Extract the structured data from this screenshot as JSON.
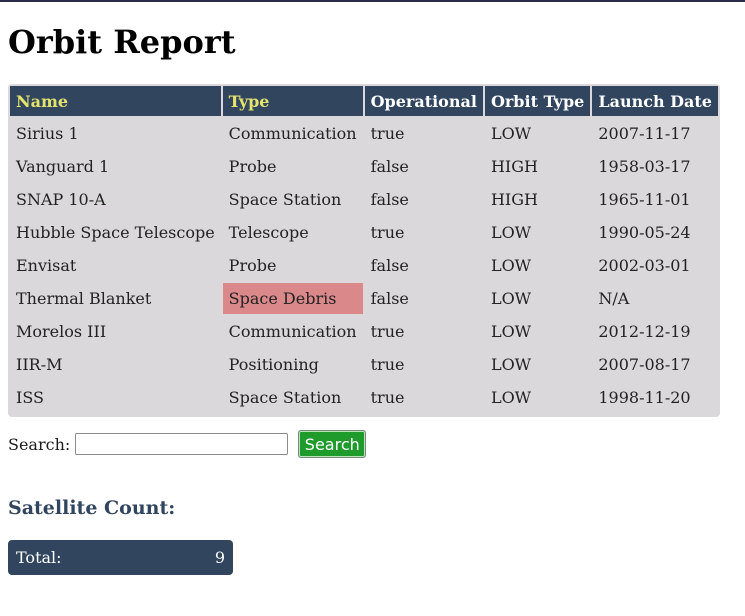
{
  "page": {
    "title": "Orbit Report"
  },
  "table": {
    "headers": [
      "Name",
      "Type",
      "Operational",
      "Orbit Type",
      "Launch Date"
    ],
    "rows": [
      [
        "Sirius 1",
        "Communication",
        "true",
        "LOW",
        "2007-11-17"
      ],
      [
        "Vanguard 1",
        "Probe",
        "false",
        "HIGH",
        "1958-03-17"
      ],
      [
        "SNAP 10-A",
        "Space Station",
        "false",
        "HIGH",
        "1965-11-01"
      ],
      [
        "Hubble Space Telescope",
        "Telescope",
        "true",
        "LOW",
        "1990-05-24"
      ],
      [
        "Envisat",
        "Probe",
        "false",
        "LOW",
        "2002-03-01"
      ],
      [
        "Thermal Blanket",
        "Space Debris",
        "false",
        "LOW",
        "N/A"
      ],
      [
        "Morelos III",
        "Communication",
        "true",
        "LOW",
        "2012-12-19"
      ],
      [
        "IIR-M",
        "Positioning",
        "true",
        "LOW",
        "2007-08-17"
      ],
      [
        "ISS",
        "Space Station",
        "true",
        "LOW",
        "1998-11-20"
      ]
    ]
  },
  "search": {
    "label": "Search:",
    "value": "",
    "button_label": "Search"
  },
  "count": {
    "heading": "Satellite Count:",
    "total_label": "Total:",
    "total_value": "9"
  },
  "colors": {
    "header_bg": "#31465e",
    "header_highlight_text": "#e3e36d",
    "table_bg": "#dad8da",
    "debris_highlight": "#db888a",
    "search_button": "#1e9b2b"
  }
}
